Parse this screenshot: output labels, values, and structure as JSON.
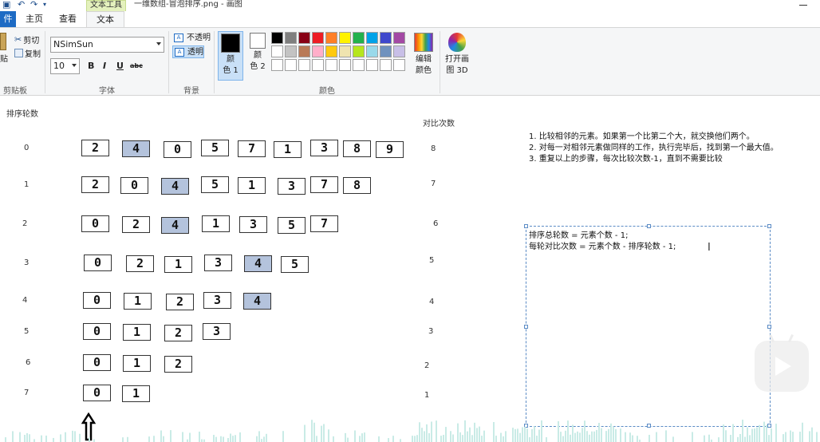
{
  "window": {
    "context_tab": "文本工具",
    "title": "一维数组-冒泡排序.png - 画图"
  },
  "tabs": [
    "件",
    "主页",
    "查看",
    "文本"
  ],
  "ribbon": {
    "clipboard": {
      "paste": "贴",
      "cut": "剪切",
      "copy": "复制",
      "label": "剪贴板"
    },
    "font": {
      "family": "NSimSun",
      "size": "10",
      "bold": "B",
      "italic": "I",
      "underline": "U",
      "strike": "abc",
      "label": "字体"
    },
    "background": {
      "opaque": "不透明",
      "transparent": "透明",
      "label": "背景"
    },
    "colors": {
      "color1": "颜色 1",
      "color1_l1": "颜",
      "color1_l2": "色 1",
      "color2_l1": "颜",
      "color2_l2": "色 2",
      "edit_l1": "编辑",
      "edit_l2": "颜色",
      "open3d_l1": "打开画",
      "open3d_l2": "图 3D",
      "label": "颜色",
      "palette_row1": [
        "#000000",
        "#7f7f7f",
        "#880015",
        "#ed1c24",
        "#ff7f27",
        "#fff200",
        "#22b14c",
        "#00a2e8",
        "#3f48cc",
        "#a349a4"
      ],
      "palette_row2": [
        "#ffffff",
        "#c3c3c3",
        "#b97a57",
        "#ffaec9",
        "#ffc90e",
        "#efe4b0",
        "#b5e61d",
        "#99d9ea",
        "#7092be",
        "#c8bfe7"
      ],
      "primary": "#000000",
      "secondary": "#ffffff"
    }
  },
  "canvas": {
    "left_header": "排序轮数",
    "right_header": "对比次数",
    "rows": [
      {
        "round": "0",
        "compares": "8",
        "values": [
          "2",
          "4",
          "0",
          "5",
          "7",
          "1",
          "3",
          "8",
          "9"
        ],
        "highlight": 1
      },
      {
        "round": "1",
        "compares": "7",
        "values": [
          "2",
          "0",
          "4",
          "5",
          "1",
          "3",
          "7",
          "8"
        ],
        "highlight": 2
      },
      {
        "round": "2",
        "compares": "6",
        "values": [
          "0",
          "2",
          "4",
          "1",
          "3",
          "5",
          "7"
        ],
        "highlight": 2
      },
      {
        "round": "3",
        "compares": "5",
        "values": [
          "0",
          "2",
          "1",
          "3",
          "4",
          "5"
        ],
        "highlight": 4
      },
      {
        "round": "4",
        "compares": "4",
        "values": [
          "0",
          "1",
          "2",
          "3",
          "4"
        ],
        "highlight": 4
      },
      {
        "round": "5",
        "compares": "3",
        "values": [
          "0",
          "1",
          "2",
          "3"
        ],
        "highlight": -1
      },
      {
        "round": "6",
        "compares": "2",
        "values": [
          "0",
          "1",
          "2"
        ],
        "highlight": -1
      },
      {
        "round": "7",
        "compares": "1",
        "values": [
          "0",
          "1"
        ],
        "highlight": -1
      }
    ],
    "notes": [
      "1. 比较相邻的元素。如果第一个比第二个大，就交换他们两个。",
      "2. 对每一对相邻元素做同样的工作，执行完毕后，找到第一个最大值。",
      "3. 重复以上的步骤，每次比较次数-1，直到不需要比较"
    ],
    "textbox_lines": [
      "排序总轮数 = 元素个数 - 1;",
      "每轮对比次数 = 元素个数 - 排序轮数 - 1;"
    ],
    "highlight_color": "#b4c3dc"
  }
}
